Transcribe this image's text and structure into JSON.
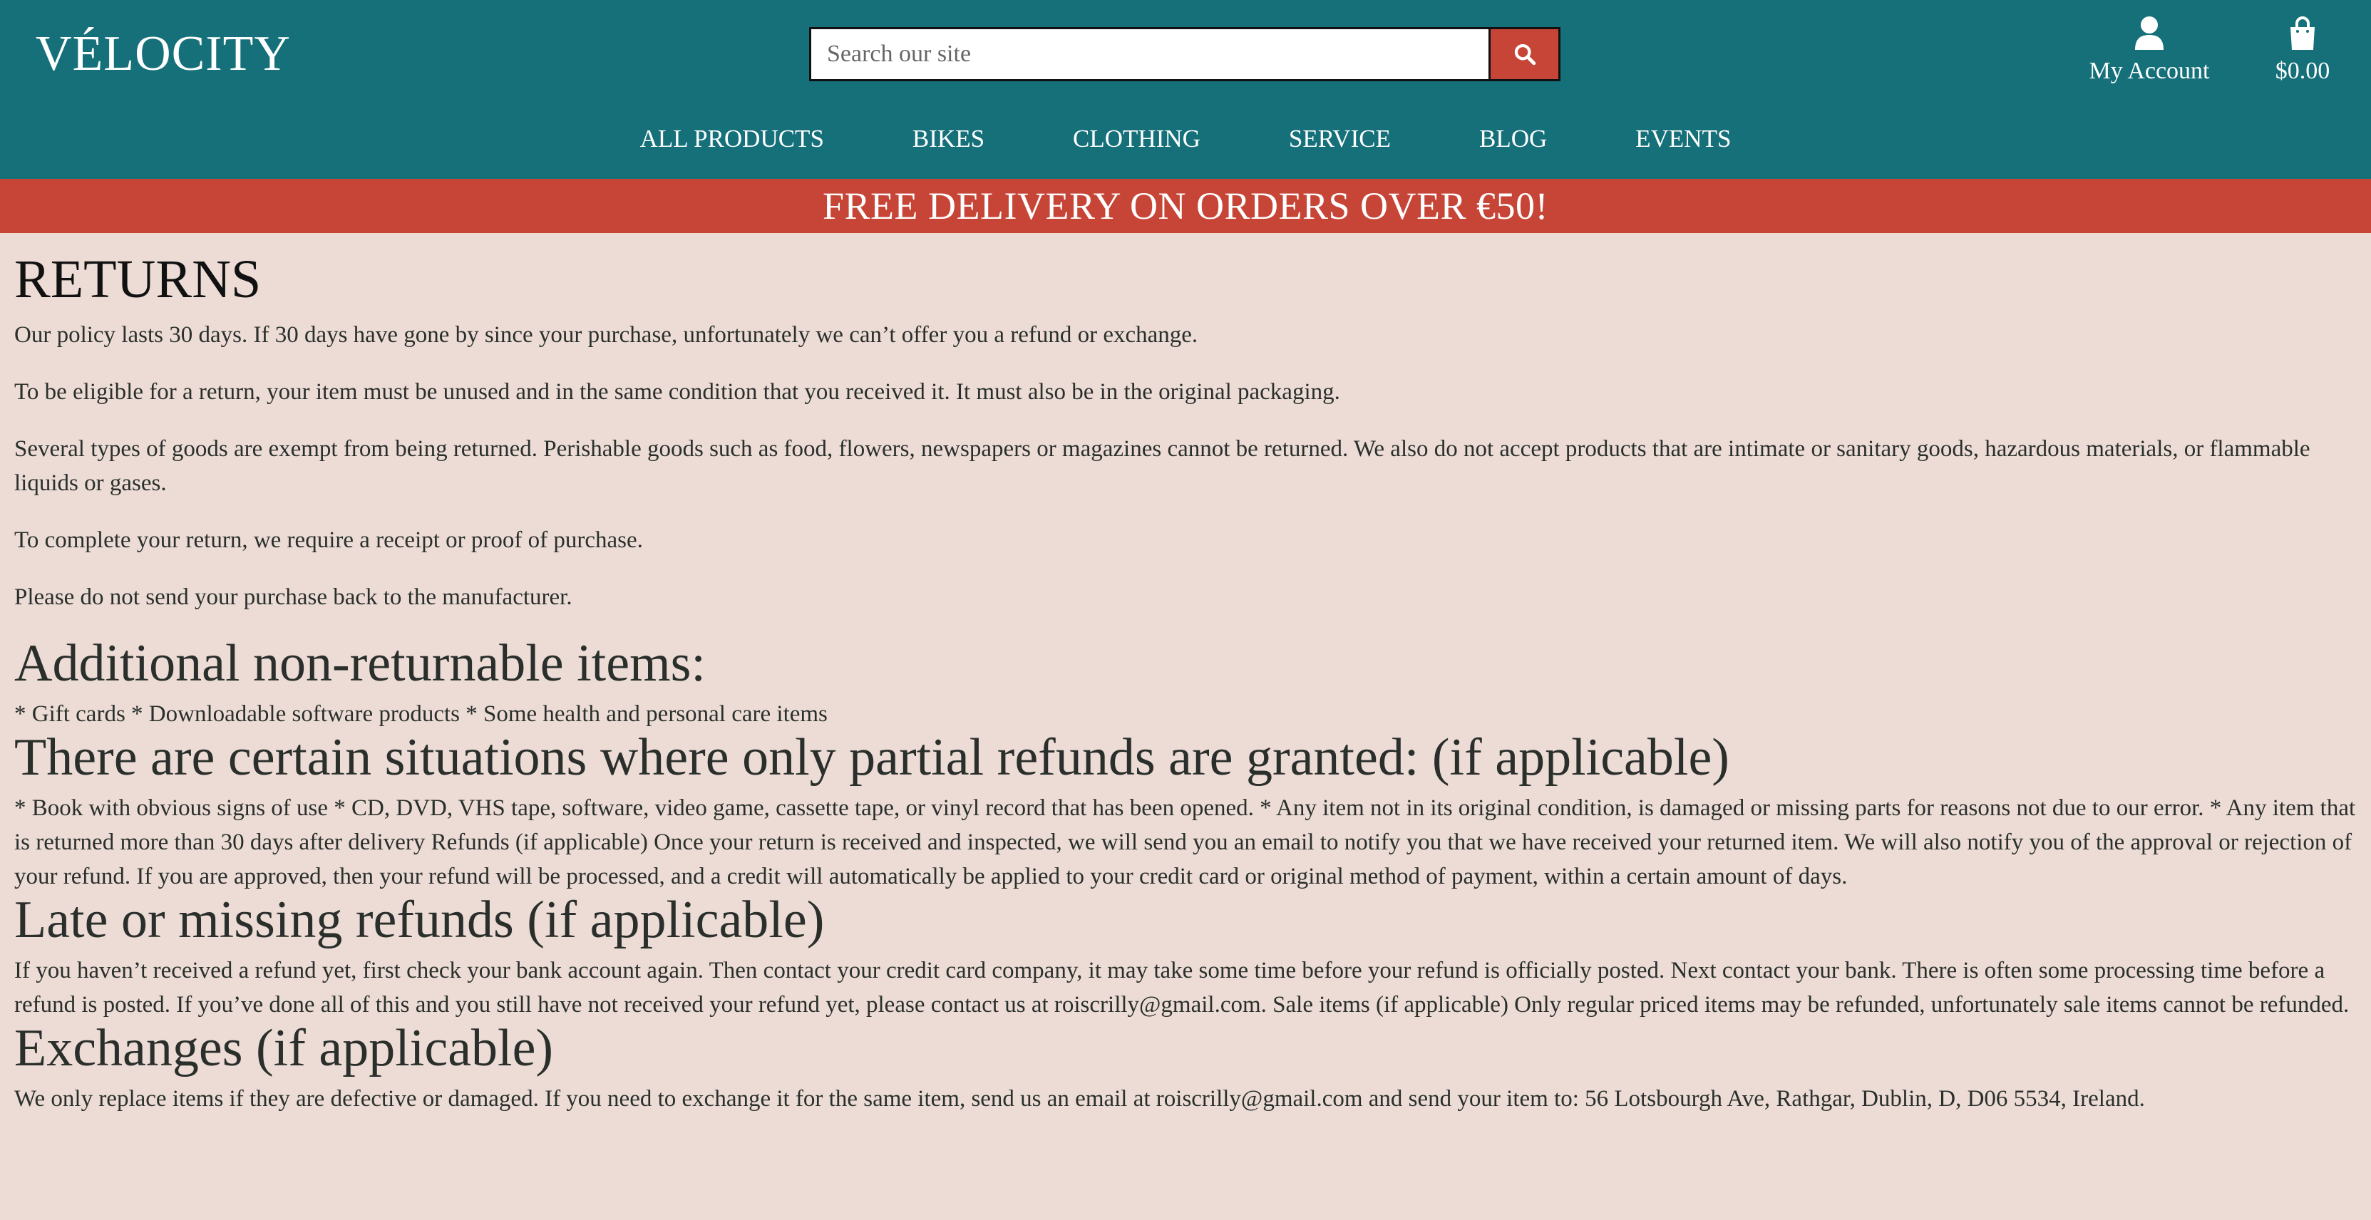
{
  "header": {
    "logo": "VÉLOCITY",
    "search": {
      "placeholder": "Search our site",
      "button_icon": "search-icon"
    },
    "account": {
      "label": "My Account",
      "icon": "user-icon"
    },
    "cart": {
      "label": "$0.00",
      "icon": "shopping-bag-icon"
    },
    "nav": [
      "ALL PRODUCTS",
      "BIKES",
      "CLOTHING",
      "SERVICE",
      "BLOG",
      "EVENTS"
    ]
  },
  "banner": {
    "text": "FREE DELIVERY ON ORDERS OVER €50!"
  },
  "colors": {
    "header_bg": "#15707a",
    "accent": "#c64537",
    "page_bg": "#ecdcd5"
  },
  "content": {
    "title": "RETURNS",
    "intro": [
      "Our policy lasts 30 days. If 30 days have gone by since your purchase, unfortunately we can’t offer you a refund or exchange.",
      "To be eligible for a return, your item must be unused and in the same condition that you received it. It must also be in the original packaging.",
      "Several types of goods are exempt from being returned. Perishable goods such as food, flowers, newspapers or magazines cannot be returned. We also do not accept products that are intimate or sanitary goods, hazardous materials, or flammable liquids or gases.",
      "To complete your return, we require a receipt or proof of purchase.",
      "Please do not send your purchase back to the manufacturer."
    ],
    "sections": [
      {
        "heading": "Additional non-returnable items:",
        "text": "* Gift cards * Downloadable software products * Some health and personal care items"
      },
      {
        "heading": "There are certain situations where only partial refunds are granted: (if applicable)",
        "text": "* Book with obvious signs of use * CD, DVD, VHS tape, software, video game, cassette tape, or vinyl record that has been opened. * Any item not in its original condition, is damaged or missing parts for reasons not due to our error. * Any item that is returned more than 30 days after delivery Refunds (if applicable) Once your return is received and inspected, we will send you an email to notify you that we have received your returned item. We will also notify you of the approval or rejection of your refund. If you are approved, then your refund will be processed, and a credit will automatically be applied to your credit card or original method of payment, within a certain amount of days."
      },
      {
        "heading": "Late or missing refunds (if applicable)",
        "text": "If you haven’t received a refund yet, first check your bank account again. Then contact your credit card company, it may take some time before your refund is officially posted. Next contact your bank. There is often some processing time before a refund is posted. If you’ve done all of this and you still have not received your refund yet, please contact us at roiscrilly@gmail.com. Sale items (if applicable) Only regular priced items may be refunded, unfortunately sale items cannot be refunded."
      },
      {
        "heading": "Exchanges (if applicable)",
        "text": "We only replace items if they are defective or damaged. If you need to exchange it for the same item, send us an email at roiscrilly@gmail.com and send your item to: 56 Lotsbourgh Ave, Rathgar, Dublin, D, D06 5534, Ireland."
      }
    ]
  }
}
